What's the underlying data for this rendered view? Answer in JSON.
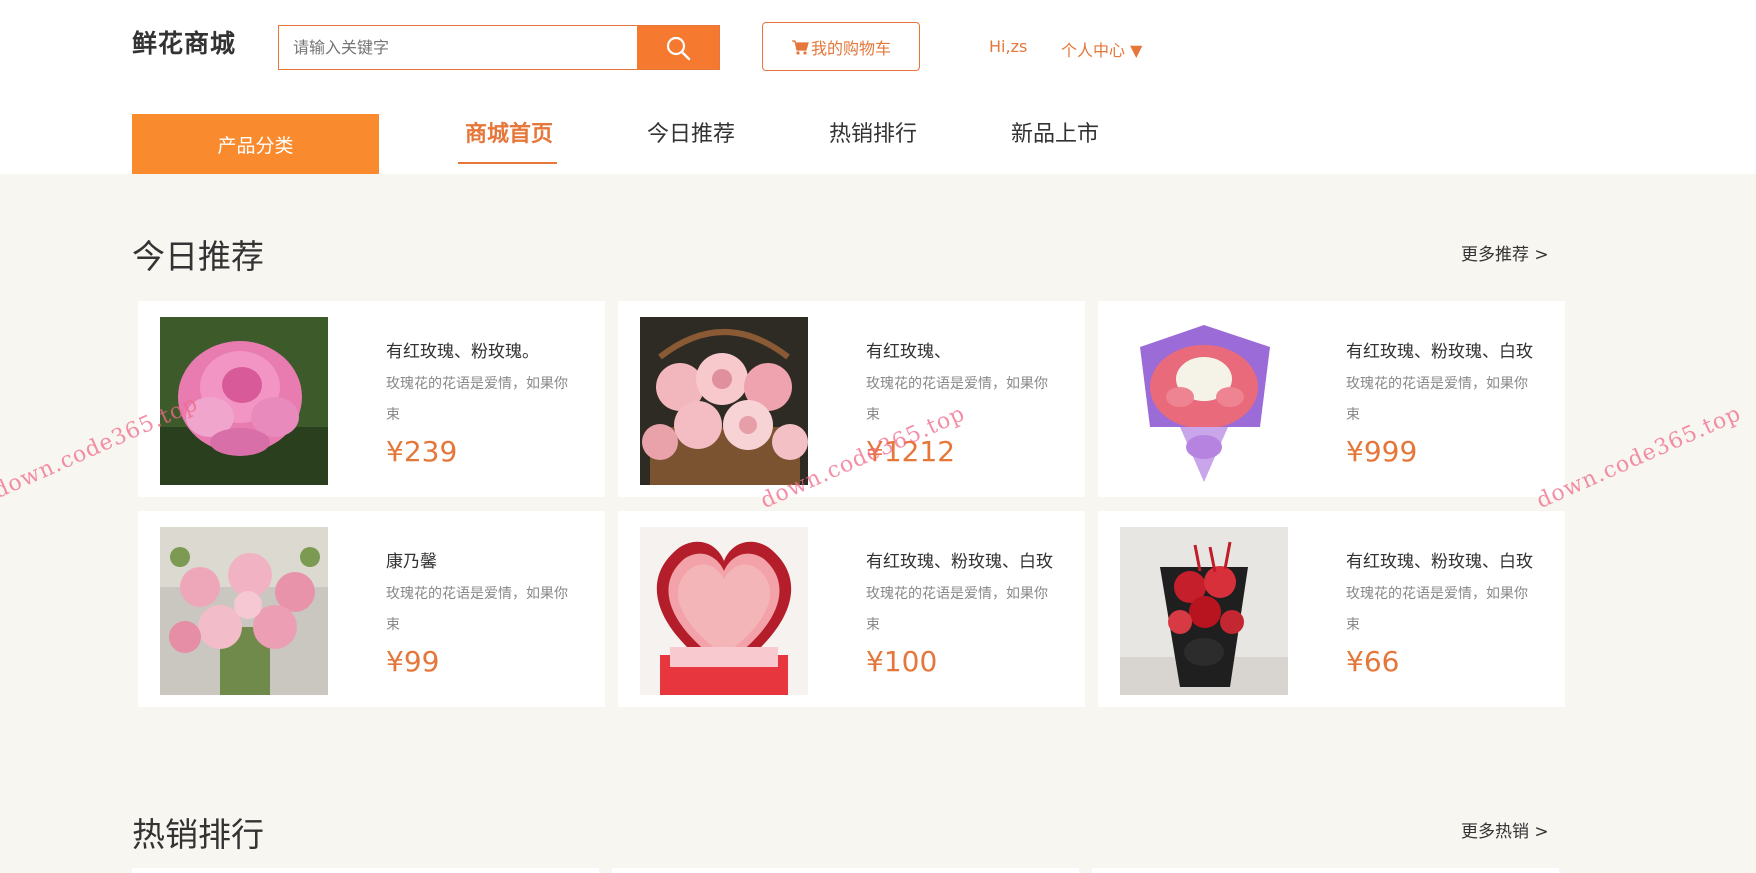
{
  "header": {
    "logo": "鲜花商城",
    "search_placeholder": "请输入关键字",
    "cart_label": "我的购物车",
    "greeting": "Hi,zs",
    "user_center": "个人中心 ▼"
  },
  "nav": {
    "category_button": "产品分类",
    "items": [
      {
        "label": "商城首页",
        "active": true
      },
      {
        "label": "今日推荐",
        "active": false
      },
      {
        "label": "热销排行",
        "active": false
      },
      {
        "label": "新品上市",
        "active": false
      }
    ]
  },
  "today": {
    "title": "今日推荐",
    "more": "更多推荐 >",
    "products": [
      {
        "name": "有红玫瑰、粉玫瑰。",
        "desc": "玫瑰花的花语是爱情，如果你束",
        "price": "¥239",
        "image": "pink-camellia"
      },
      {
        "name": "有红玫瑰、",
        "desc": "玫瑰花的花语是爱情，如果你束",
        "price": "¥1212",
        "image": "rose-basket"
      },
      {
        "name": "有红玫瑰、粉玫瑰、白玫",
        "desc": "玫瑰花的花语是爱情，如果你束",
        "price": "¥999",
        "image": "purple-bouquet"
      },
      {
        "name": "康乃馨",
        "desc": "玫瑰花的花语是爱情，如果你束",
        "price": "¥99",
        "image": "pink-lisianthus"
      },
      {
        "name": "有红玫瑰、粉玫瑰、白玫",
        "desc": "玫瑰花的花语是爱情，如果你束",
        "price": "¥100",
        "image": "heart-rose-box"
      },
      {
        "name": "有红玫瑰、粉玫瑰、白玫",
        "desc": "玫瑰花的花语是爱情，如果你束",
        "price": "¥66",
        "image": "red-bouquet-black"
      }
    ]
  },
  "hot": {
    "title": "热销排行",
    "more": "更多热销 >"
  },
  "watermark": "down.code365.top"
}
